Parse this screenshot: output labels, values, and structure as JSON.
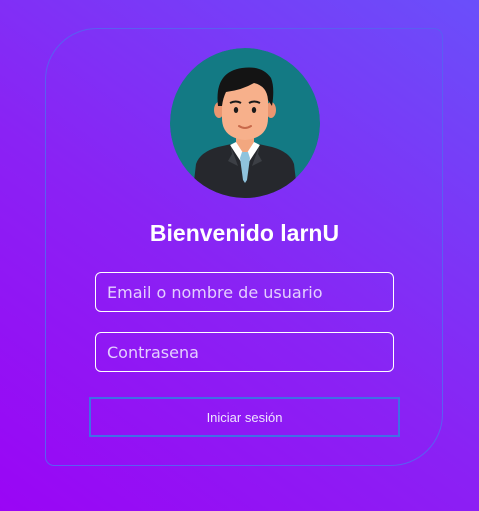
{
  "login": {
    "welcome_title": "Bienvenido larnU",
    "email_placeholder": "Email o nombre de usuario",
    "password_placeholder": "Contrasena",
    "submit_label": "Iniciar sesión"
  },
  "avatar": {
    "icon": "user-avatar-icon",
    "background_color": "#137a84"
  },
  "colors": {
    "background_start": "#9a05f5",
    "background_end": "#6a4ffa",
    "card_border": "#5a5ef2",
    "button_border": "#3f6fe6",
    "text": "#ffffff"
  }
}
